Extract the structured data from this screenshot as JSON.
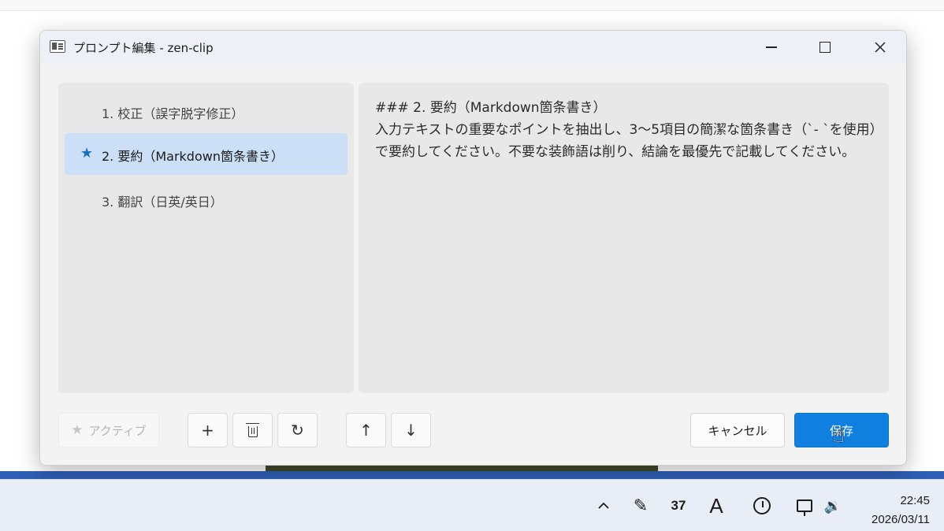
{
  "window": {
    "title": "プロンプト編集 - zen-clip"
  },
  "prompt_list": {
    "items": [
      {
        "label": "1. 校正（誤字脱字修正）",
        "active": false,
        "selected": false
      },
      {
        "label": "2. 要約（Markdown箇条書き）",
        "active": true,
        "selected": true,
        "marker": "★"
      },
      {
        "label": "3. 翻訳（日英/英日）",
        "active": false,
        "selected": false
      }
    ]
  },
  "editor": {
    "content": "### 2. 要約（Markdown箇条書き）\n入力テキストの重要なポイントを抽出し、3〜5項目の簡潔な箇条書き（`- `を使用）で要約してください。不要な装飾語は削り、結論を最優先で記載してください。"
  },
  "toolbar": {
    "active_label": "アクティブ",
    "active_icon": "★",
    "add_icon": "+",
    "reset_icon": "↻",
    "up_icon": "↑",
    "down_icon": "↓",
    "cancel_label": "キャンセル",
    "save_label": "保存"
  },
  "taskbar": {
    "chevron_icon": "^",
    "pen_icon": "✎",
    "badge_number": "37",
    "ime_icon": "A",
    "volume_icon": "🔉",
    "time": "22:45",
    "date": "2026/03/11"
  },
  "colors": {
    "accent": "#0f7fe0",
    "selected_row": "#cbe0f6",
    "star": "#1b6fc2",
    "panel_bg": "#e8e8e8"
  }
}
